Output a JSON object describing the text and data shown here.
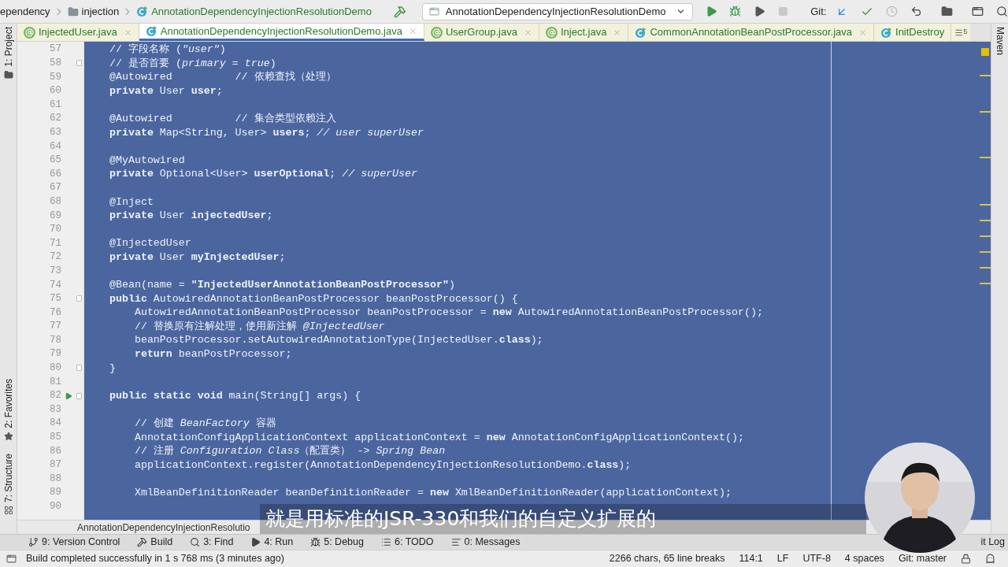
{
  "nav_bar": {
    "breadcrumbs": [
      {
        "label": "ependency",
        "kind": "text"
      },
      {
        "label": "injection",
        "kind": "folder"
      },
      {
        "label": "AnnotationDependencyInjectionResolutionDemo",
        "kind": "class"
      }
    ],
    "run_config": "AnnotationDependencyInjectionResolutionDemo",
    "git_label": "Git:"
  },
  "left_strip": [
    {
      "label": "1: Project",
      "kind": "folder"
    },
    {
      "label": "2: Favorites",
      "kind": "star"
    },
    {
      "label": "7: Structure",
      "kind": "structure"
    }
  ],
  "right_strip": [
    {
      "label": "Maven"
    }
  ],
  "tabs": [
    {
      "label": "InjectedUser.java",
      "kind": "annotation",
      "selected": false
    },
    {
      "label": "AnnotationDependencyInjectionResolutionDemo.java",
      "kind": "class",
      "selected": true
    },
    {
      "label": "UserGroup.java",
      "kind": "annotation",
      "selected": false
    },
    {
      "label": "Inject.java",
      "kind": "annotation",
      "selected": false
    },
    {
      "label": "CommonAnnotationBeanPostProcessor.java",
      "kind": "class",
      "selected": false
    },
    {
      "label": "InitDestroy",
      "kind": "class",
      "selected": false
    }
  ],
  "tabs_overflow": "5",
  "editor": {
    "lines": [
      {
        "number": "57",
        "text": "// 字段名称 (*\"user\"*)"
      },
      {
        "number": "58",
        "text": "// 是否首要 (*primary = true*)",
        "fold": true
      },
      {
        "number": "59",
        "text": "@Autowired          // 依赖查找（处理）"
      },
      {
        "number": "60",
        "text": "**private** User **user**;"
      },
      {
        "number": "61"
      },
      {
        "number": "62",
        "text": "@Autowired          // 集合类型依赖注入"
      },
      {
        "number": "63",
        "text": "**private** Map<String, User> **users**; *// user superUser*"
      },
      {
        "number": "64"
      },
      {
        "number": "65",
        "text": "@MyAutowired"
      },
      {
        "number": "66",
        "text": "**private** Optional<User> **userOptional**; *// superUser*"
      },
      {
        "number": "67"
      },
      {
        "number": "68",
        "text": "@Inject"
      },
      {
        "number": "69",
        "text": "**private** User **injectedUser**;"
      },
      {
        "number": "70"
      },
      {
        "number": "71",
        "text": "@InjectedUser"
      },
      {
        "number": "72",
        "text": "**private** User **myInjectedUser**;"
      },
      {
        "number": "73"
      },
      {
        "number": "74",
        "text": "@Bean(name = **\"InjectedUserAnnotationBeanPostProcessor\"**)"
      },
      {
        "number": "75",
        "text": "**public** AutowiredAnnotationBeanPostProcessor beanPostProcessor() {",
        "fold": true
      },
      {
        "number": "76",
        "text": "    AutowiredAnnotationBeanPostProcessor beanPostProcessor = **new** AutowiredAnnotationBeanPostProcessor();"
      },
      {
        "number": "77",
        "text": "    // 替换原有注解处理，使用新注解 *@InjectedUser*"
      },
      {
        "number": "78",
        "text": "    beanPostProcessor.setAutowiredAnnotationType(InjectedUser.**class**);"
      },
      {
        "number": "79",
        "text": "    **return** beanPostProcessor;"
      },
      {
        "number": "80",
        "text": "}",
        "fold": true
      },
      {
        "number": "81"
      },
      {
        "number": "82",
        "text": "**public static void** main(String[] args) {",
        "run": true,
        "fold": true
      },
      {
        "number": "83"
      },
      {
        "number": "84",
        "text": "    // 创建 *BeanFactory* 容器"
      },
      {
        "number": "85",
        "text": "    AnnotationConfigApplicationContext applicationContext = **new** AnnotationConfigApplicationContext();"
      },
      {
        "number": "86",
        "text": "    // 注册 *Configuration Class*（配置类） -> *Spring Bean*"
      },
      {
        "number": "87",
        "text": "    applicationContext.register(AnnotationDependencyInjectionResolutionDemo.**class**);"
      },
      {
        "number": "88"
      },
      {
        "number": "89",
        "text": "    XmlBeanDefinitionReader beanDefinitionReader = **new** XmlBeanDefinitionReader(applicationContext);"
      },
      {
        "number": "90"
      }
    ]
  },
  "footer_breadcrumb": "AnnotationDependencyInjectionResolutio",
  "tool_windows": [
    {
      "label": "9: Version Control",
      "kind": "vcs"
    },
    {
      "label": "Build",
      "kind": "build"
    },
    {
      "label": "3: Find",
      "kind": "find"
    },
    {
      "label": "4: Run",
      "kind": "run"
    },
    {
      "label": "5: Debug",
      "kind": "debug"
    },
    {
      "label": "6: TODO",
      "kind": "todo"
    },
    {
      "label": "0: Messages",
      "kind": "messages"
    }
  ],
  "tool_windows_right": [
    "it Log"
  ],
  "status_bar": {
    "message": "Build completed successfully in 1 s 768 ms (3 minutes ago)",
    "items": [
      "2266 chars, 65 line breaks",
      "114:1",
      "LF",
      "UTF-8",
      "4 spaces",
      "Git: master"
    ]
  },
  "subtitle": "就是用标准的JSR-330和我们的自定义扩展的"
}
